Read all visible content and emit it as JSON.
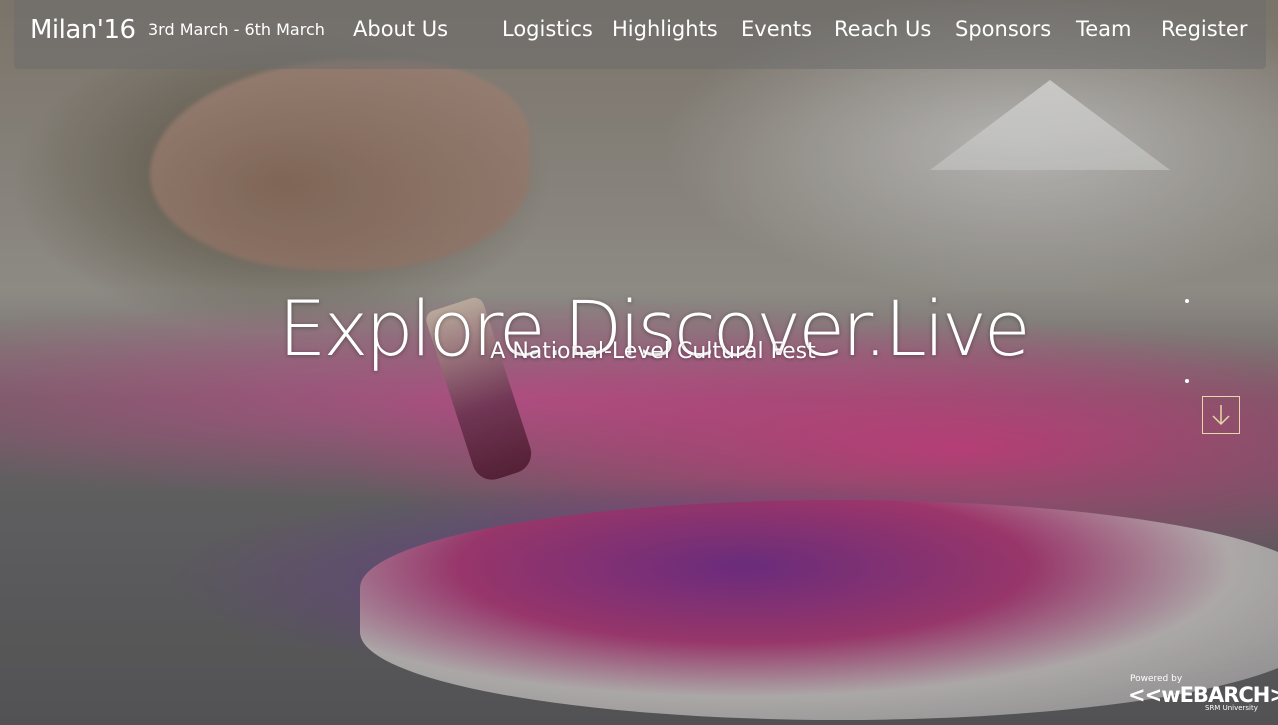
{
  "header": {
    "brand": "Milan'16",
    "dates": "3rd March - 6th March",
    "nav": [
      {
        "label": "About Us"
      },
      {
        "label": "Logistics"
      },
      {
        "label": "Highlights"
      },
      {
        "label": "Events"
      },
      {
        "label": "Reach Us"
      },
      {
        "label": "Sponsors"
      },
      {
        "label": "Team"
      },
      {
        "label": "Register"
      }
    ]
  },
  "hero": {
    "headline": "Explore.Discover.Live",
    "subheadline": "A National-Level Cultural Fest",
    "scroll_icon": "arrow-down-icon"
  },
  "footer": {
    "powered_by": "Powered by",
    "logo_text": "<<wEBARCH>>",
    "university": "SRM University"
  },
  "colors": {
    "nav_bg": "#6e6e6e",
    "text": "#ffffff",
    "scroll_border": "#e7d9a7"
  }
}
